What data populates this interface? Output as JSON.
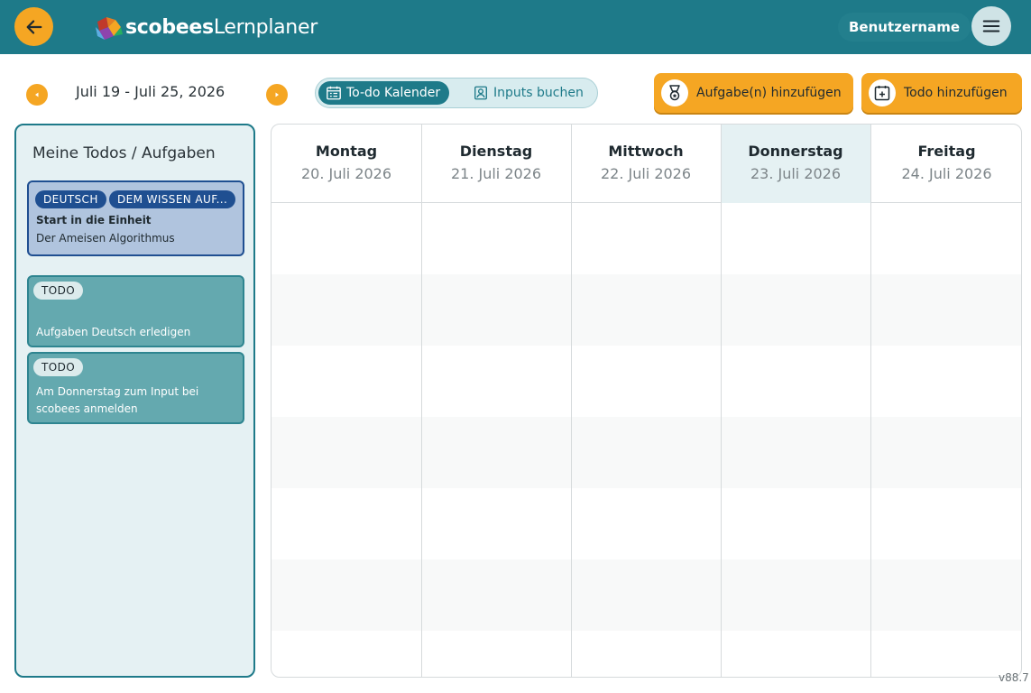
{
  "header": {
    "logo_brand": "scobees",
    "logo_product": "Lernplaner",
    "username": "Benutzername"
  },
  "toolbar": {
    "date_range": "Juli 19 - Juli 25, 2026",
    "views": {
      "active_label": "To-do Kalender",
      "inactive_label": "Inputs buchen"
    },
    "add_task_label": "Aufgabe(n) hinzufügen",
    "add_todo_label": "Todo hinzufügen"
  },
  "sidebar": {
    "title": "Meine Todos / Aufgaben",
    "task_card": {
      "tags": [
        "DEUTSCH",
        "DEM WISSEN AUF..."
      ],
      "title": "Start in die Einheit",
      "subtitle": "Der Ameisen Algorithmus"
    },
    "todos": [
      {
        "tag": "TODO",
        "text": "Aufgaben Deutsch erledigen"
      },
      {
        "tag": "TODO",
        "text": "Am Donnerstag zum Input bei scobees anmelden"
      }
    ]
  },
  "calendar": {
    "days": [
      {
        "name": "Montag",
        "date": "20. Juli 2026",
        "today": false
      },
      {
        "name": "Dienstag",
        "date": "21. Juli 2026",
        "today": false
      },
      {
        "name": "Mittwoch",
        "date": "22. Juli 2026",
        "today": false
      },
      {
        "name": "Donnerstag",
        "date": "23. Juli 2026",
        "today": true
      },
      {
        "name": "Freitag",
        "date": "24. Juli 2026",
        "today": false
      }
    ]
  },
  "version": "v88.7",
  "colors": {
    "primary": "#1e7a89",
    "accent": "#f5a623",
    "task_blue": "#1f4f91",
    "todo_teal": "#64a9af"
  },
  "icons": [
    "arrow-left-icon",
    "logo-cube-icon",
    "hamburger-menu-icon",
    "chevron-left-icon",
    "chevron-right-icon",
    "calendar-list-icon",
    "person-badge-icon",
    "medal-icon",
    "calendar-plus-icon"
  ]
}
